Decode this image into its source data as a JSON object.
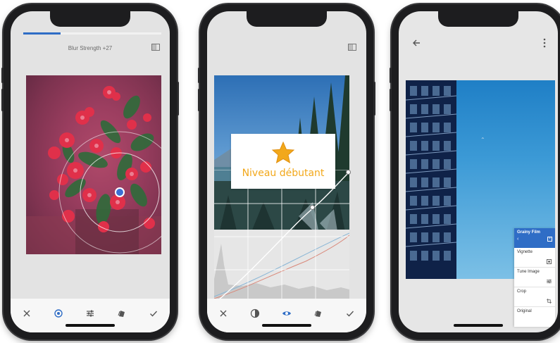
{
  "phone1": {
    "blur_label": "Blur Strength +27",
    "blur_strength_progress": 0.27,
    "toolbar": [
      "close-icon",
      "focus-target-icon",
      "tune-sliders-icon",
      "styles-icon",
      "apply-check-icon"
    ]
  },
  "phone2": {
    "level_label": "Niveau débutant",
    "toolbar": [
      "close-icon",
      "preset-icon",
      "eye-icon",
      "styles-icon",
      "apply-check-icon"
    ]
  },
  "phone3": {
    "menu": {
      "header_title": "Grainy Film",
      "items": [
        {
          "label": "Vignette",
          "icon": "vignette-icon"
        },
        {
          "label": "Tune Image",
          "icon": "tune-sliders-icon"
        },
        {
          "label": "Crop",
          "icon": "crop-icon"
        },
        {
          "label": "Original",
          "icon": ""
        }
      ]
    }
  },
  "colors": {
    "accent_blue": "#2f6dc6",
    "star_orange": "#f2a81b"
  }
}
